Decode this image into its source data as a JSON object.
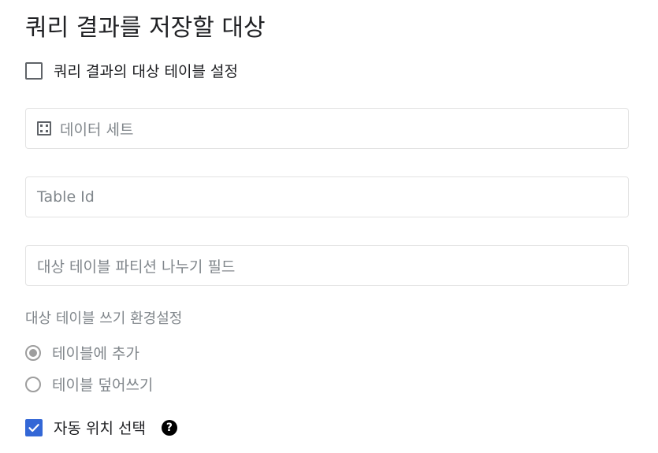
{
  "header": {
    "title": "쿼리 결과를 저장할 대상"
  },
  "destination_checkbox": {
    "label": "쿼리 결과의 대상 테이블 설정",
    "checked": false
  },
  "fields": {
    "dataset": {
      "placeholder": "데이터 세트",
      "icon": "dataset-grid-icon"
    },
    "table_id": {
      "placeholder": "Table Id"
    },
    "partition_field": {
      "placeholder": "대상 테이블 파티션 나누기 필드"
    }
  },
  "write_preference": {
    "label": "대상 테이블 쓰기 환경설정",
    "options": [
      {
        "label": "테이블에 추가",
        "selected": true
      },
      {
        "label": "테이블 덮어쓰기",
        "selected": false
      }
    ]
  },
  "auto_location": {
    "label": "자동 위치 선택",
    "checked": true,
    "help_icon": "help-icon",
    "help_glyph": "?"
  },
  "colors": {
    "accent": "#3367d6",
    "muted_text": "#80868b",
    "border": "#e3e3e3"
  }
}
